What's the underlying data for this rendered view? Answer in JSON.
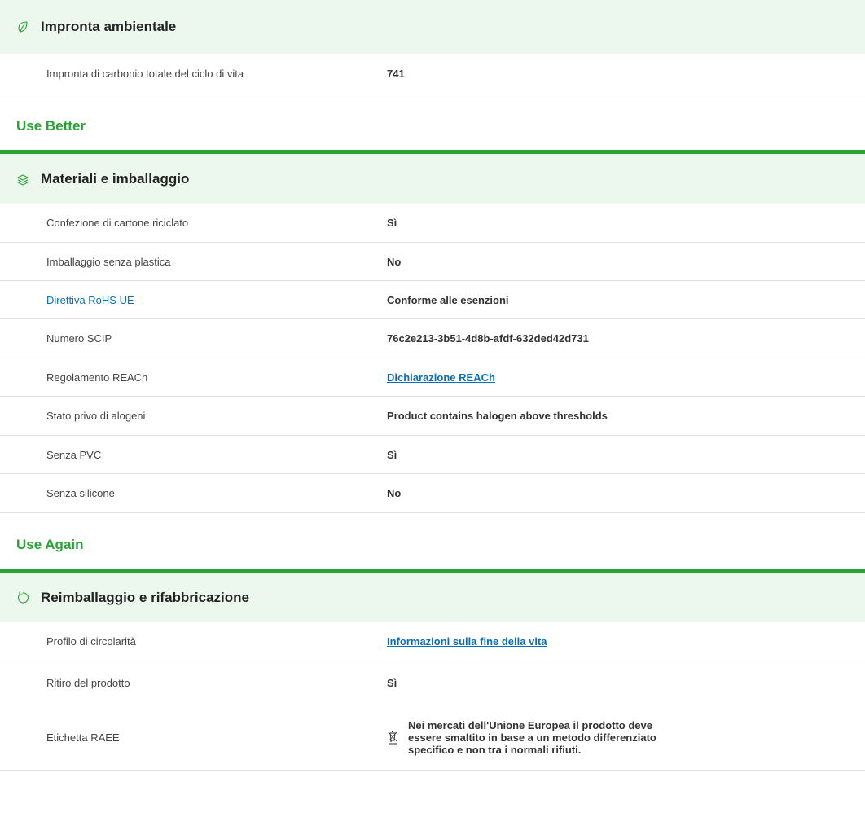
{
  "sections": {
    "footprint": {
      "title": "Impronta ambientale",
      "icon": "leaf-icon",
      "rows": [
        {
          "label": "Impronta di carbonio totale del ciclo di vita",
          "value": "741"
        }
      ]
    },
    "use_better": {
      "heading": "Use Better",
      "title": "Materiali e imballaggio",
      "icon": "layers-icon",
      "rows": [
        {
          "label": "Confezione di cartone riciclato",
          "value": "Sì"
        },
        {
          "label": "Imballaggio senza plastica",
          "value": "No"
        },
        {
          "label": "Direttiva RoHS UE",
          "value": "Conforme alle esenzioni"
        },
        {
          "label": "Numero SCIP",
          "value": "76c2e213-3b51-4d8b-afdf-632ded42d731"
        },
        {
          "label": "Regolamento REACh",
          "value": "Dichiarazione REACh"
        },
        {
          "label": "Stato privo di alogeni",
          "value": "Product contains halogen above thresholds"
        },
        {
          "label": "Senza PVC",
          "value": "Sì"
        },
        {
          "label": "Senza silicone",
          "value": "No"
        }
      ]
    },
    "use_again": {
      "heading": "Use Again",
      "title": "Reimballaggio e rifabbricazione",
      "icon": "refresh-icon",
      "rows": [
        {
          "label": "Profilo di circolarità",
          "value": "Informazioni sulla fine della vita"
        },
        {
          "label": "Ritiro del prodotto",
          "value": "Sì"
        },
        {
          "label": "Etichetta RAEE",
          "value": "Nei mercati dell'Unione Europea il prodotto deve essere smaltito in base a un metodo differenziato specifico e non tra i normali rifiuti."
        }
      ]
    }
  },
  "colors": {
    "accent_green": "#2aa336",
    "header_bg": "#ecf8ee",
    "link_blue": "#0a6fb5"
  }
}
